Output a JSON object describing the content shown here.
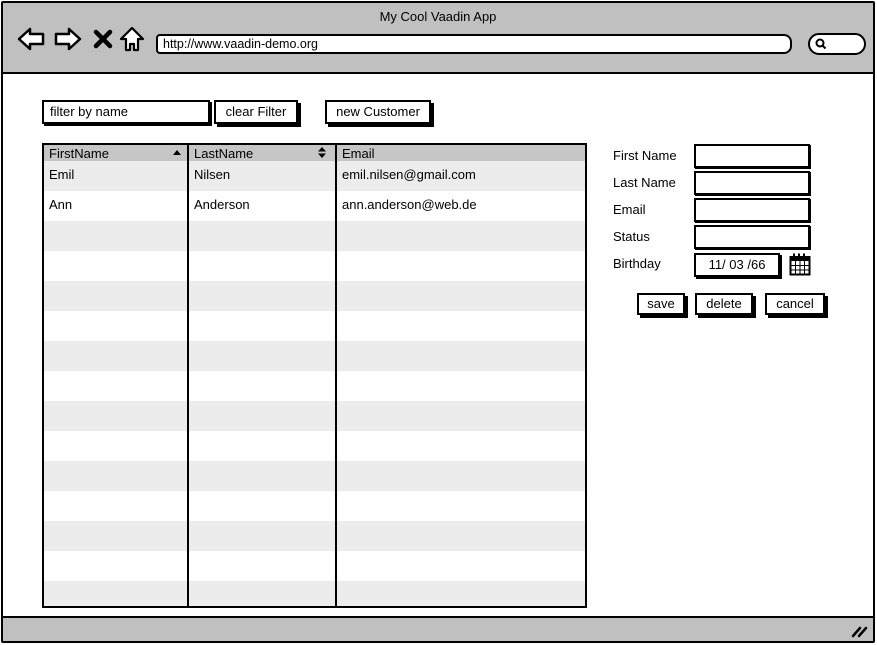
{
  "browser": {
    "title": "My Cool Vaadin App",
    "url": "http://www.vaadin-demo.org",
    "nav_icons": [
      "back-arrow-icon",
      "forward-arrow-icon",
      "stop-icon",
      "home-icon"
    ],
    "search_icon": "search-icon"
  },
  "toolbar": {
    "filter_placeholder": "filter by name",
    "clear_filter_label": "clear Filter",
    "new_customer_label": "new Customer"
  },
  "grid": {
    "columns": [
      {
        "label": "FirstName",
        "sort": "ascending"
      },
      {
        "label": "LastName",
        "sort": "sortable"
      },
      {
        "label": "Email",
        "sort": "none"
      }
    ],
    "rows": [
      {
        "first": "Emil",
        "last": "Nilsen",
        "email": "emil.nilsen@gmail.com"
      },
      {
        "first": "Ann",
        "last": "Anderson",
        "email": "ann.anderson@web.de"
      }
    ],
    "visible_row_count": 15
  },
  "form": {
    "labels": {
      "first_name": "First Name",
      "last_name": "Last Name",
      "email": "Email",
      "status": "Status",
      "birthday": "Birthday"
    },
    "values": {
      "first_name": "",
      "last_name": "",
      "email": "",
      "status": "",
      "birthday": "11/ 03 /66"
    },
    "buttons": {
      "save": "save",
      "delete": "delete",
      "cancel": "cancel"
    }
  },
  "colors": {
    "chrome": "#c0c0c0",
    "header": "#c6c6c6",
    "stripe": "#ececec",
    "border": "#000000"
  }
}
